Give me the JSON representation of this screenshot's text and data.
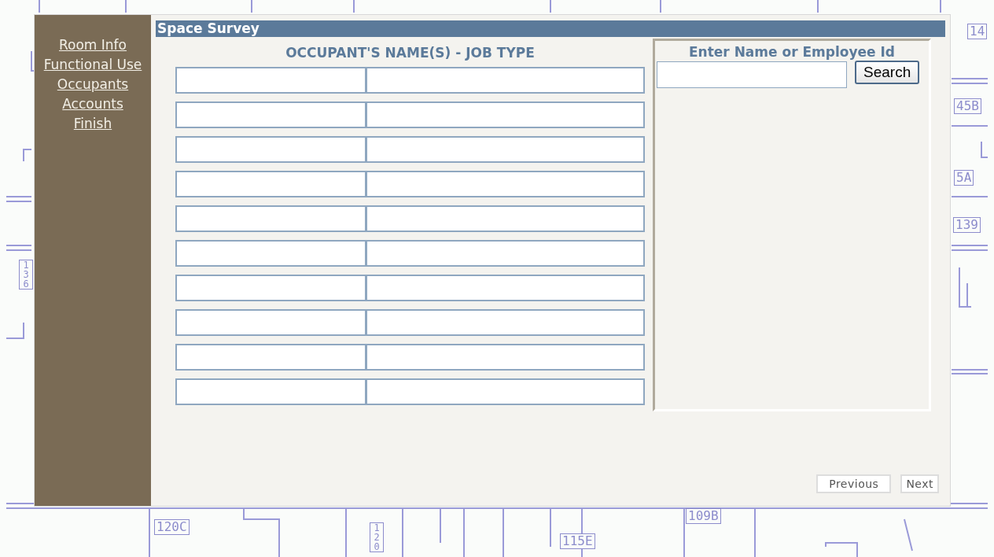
{
  "floor_plan": {
    "room_labels": [
      {
        "text": "14",
        "kind": "flat"
      },
      {
        "text": "45B",
        "kind": "flat"
      },
      {
        "text": "5A",
        "kind": "flat"
      },
      {
        "text": "139",
        "kind": "flat"
      },
      {
        "text": "136",
        "kind": "vertical"
      },
      {
        "text": "120C",
        "kind": "flat"
      },
      {
        "text": "109B",
        "kind": "flat"
      },
      {
        "text": "115E",
        "kind": "flat"
      },
      {
        "text": "120",
        "kind": "vertical"
      }
    ]
  },
  "sidebar": {
    "items": [
      {
        "label": "Room Info"
      },
      {
        "label": "Functional Use"
      },
      {
        "label": "Occupants"
      },
      {
        "label": "Accounts"
      },
      {
        "label": "Finish"
      }
    ]
  },
  "window": {
    "title": "Space Survey"
  },
  "occupants": {
    "heading": "OCCUPANT'S NAME(S) - JOB TYPE",
    "rows": [
      {
        "kind": "name-job"
      },
      {
        "kind": "name-job"
      },
      {
        "kind": "name-job"
      },
      {
        "kind": "name-job"
      },
      {
        "kind": "name-job"
      },
      {
        "kind": "name-job"
      },
      {
        "kind": "name-job"
      },
      {
        "kind": "name-job"
      },
      {
        "kind": "name-job"
      },
      {
        "kind": "name-job"
      }
    ]
  },
  "search_panel": {
    "heading": "Enter Name or Employee Id",
    "button": "Search"
  },
  "buttons": [
    "Previous",
    "Next"
  ]
}
